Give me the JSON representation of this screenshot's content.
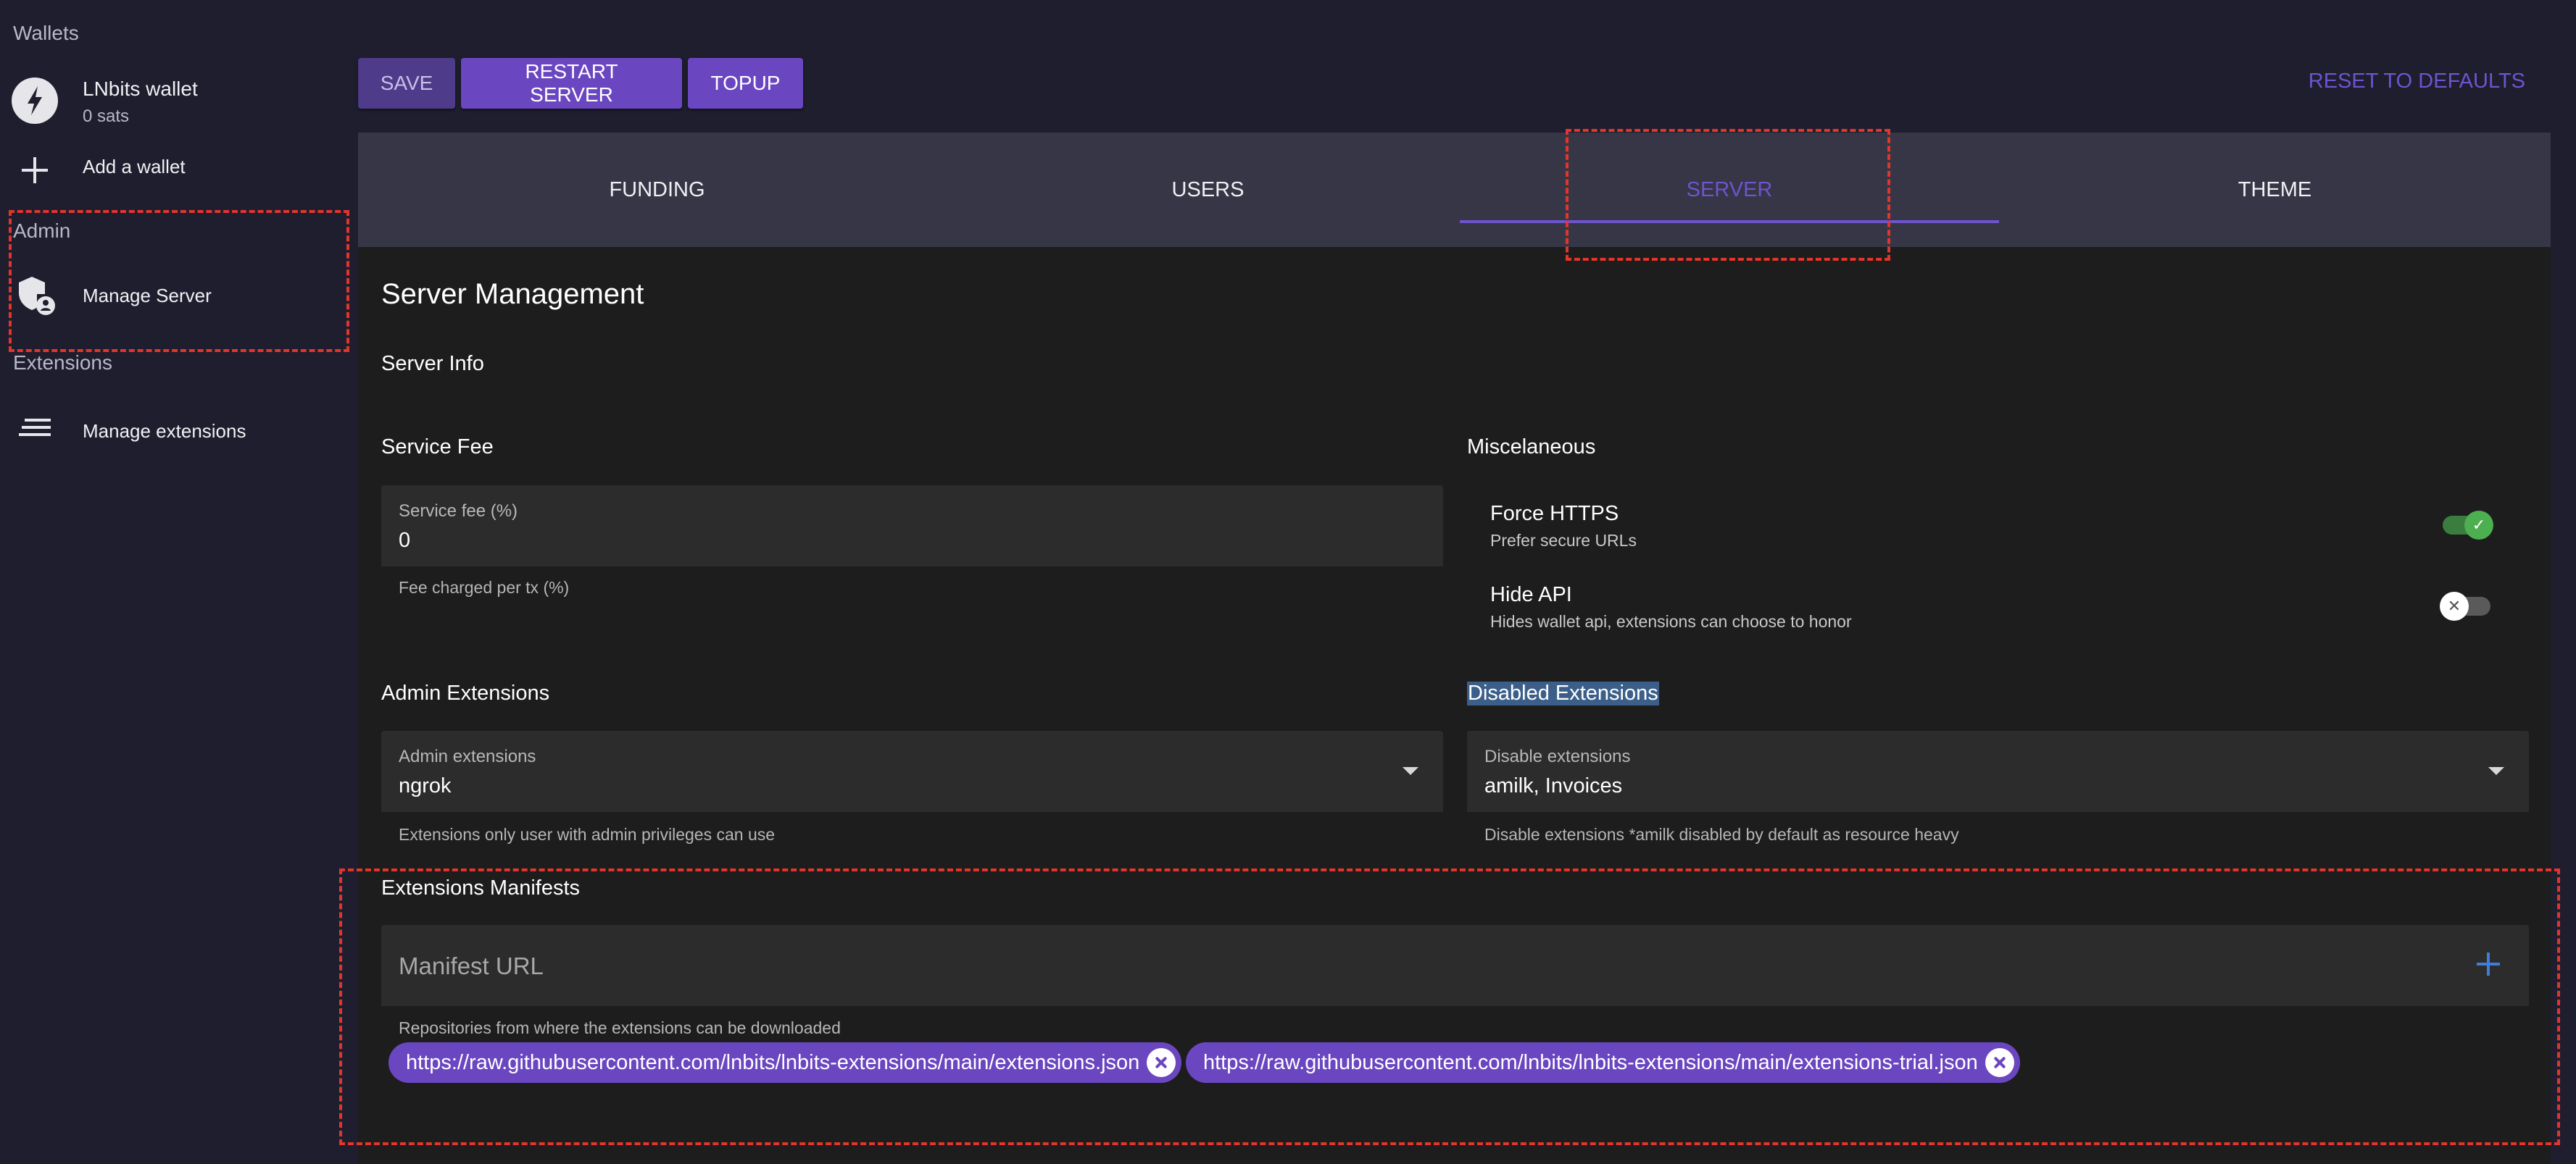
{
  "sidebar": {
    "wallets_heading": "Wallets",
    "wallet": {
      "name": "LNbits wallet",
      "balance": "0 sats",
      "icon": "bolt-icon"
    },
    "add_wallet": {
      "label": "Add a wallet",
      "icon": "plus-icon"
    },
    "admin_heading": "Admin",
    "manage_server": {
      "label": "Manage Server",
      "icon": "admin-shield-icon"
    },
    "extensions_heading": "Extensions",
    "manage_extensions": {
      "label": "Manage extensions",
      "icon": "menu-lines-icon"
    }
  },
  "toolbar": {
    "save_label": "SAVE",
    "restart_label": "RESTART SERVER",
    "topup_label": "TOPUP",
    "reset_label": "RESET TO DEFAULTS"
  },
  "tabs": [
    {
      "label": "FUNDING",
      "active": false
    },
    {
      "label": "USERS",
      "active": false
    },
    {
      "label": "SERVER",
      "active": true
    },
    {
      "label": "THEME",
      "active": false
    }
  ],
  "server": {
    "title": "Server Management",
    "info_heading": "Server Info",
    "service_fee": {
      "heading": "Service Fee",
      "label": "Service fee (%)",
      "value": "0",
      "hint": "Fee charged per tx (%)"
    },
    "misc": {
      "heading": "Miscelaneous",
      "force_https": {
        "title": "Force HTTPS",
        "subtitle": "Prefer secure URLs",
        "enabled": true
      },
      "hide_api": {
        "title": "Hide API",
        "subtitle": "Hides wallet api, extensions can choose to honor",
        "enabled": false
      }
    },
    "admin_extensions": {
      "heading": "Admin Extensions",
      "label": "Admin extensions",
      "value": "ngrok",
      "hint": "Extensions only user with admin privileges can use"
    },
    "disabled_extensions": {
      "heading": "Disabled Extensions",
      "label": "Disable extensions",
      "value": "amilk, Invoices",
      "hint": "Disable extensions *amilk disabled by default as resource heavy"
    },
    "manifests": {
      "heading": "Extensions Manifests",
      "placeholder": "Manifest URL",
      "hint": "Repositories from where the extensions can be downloaded",
      "urls": [
        "https://raw.githubusercontent.com/lnbits/lnbits-extensions/main/extensions.json",
        "https://raw.githubusercontent.com/lnbits/lnbits-extensions/main/extensions-trial.json"
      ]
    }
  },
  "colors": {
    "accent": "#6b46c1",
    "toggle_on": "#4caf50",
    "background": "#1e1e2e",
    "annotation": "#e2352c"
  }
}
